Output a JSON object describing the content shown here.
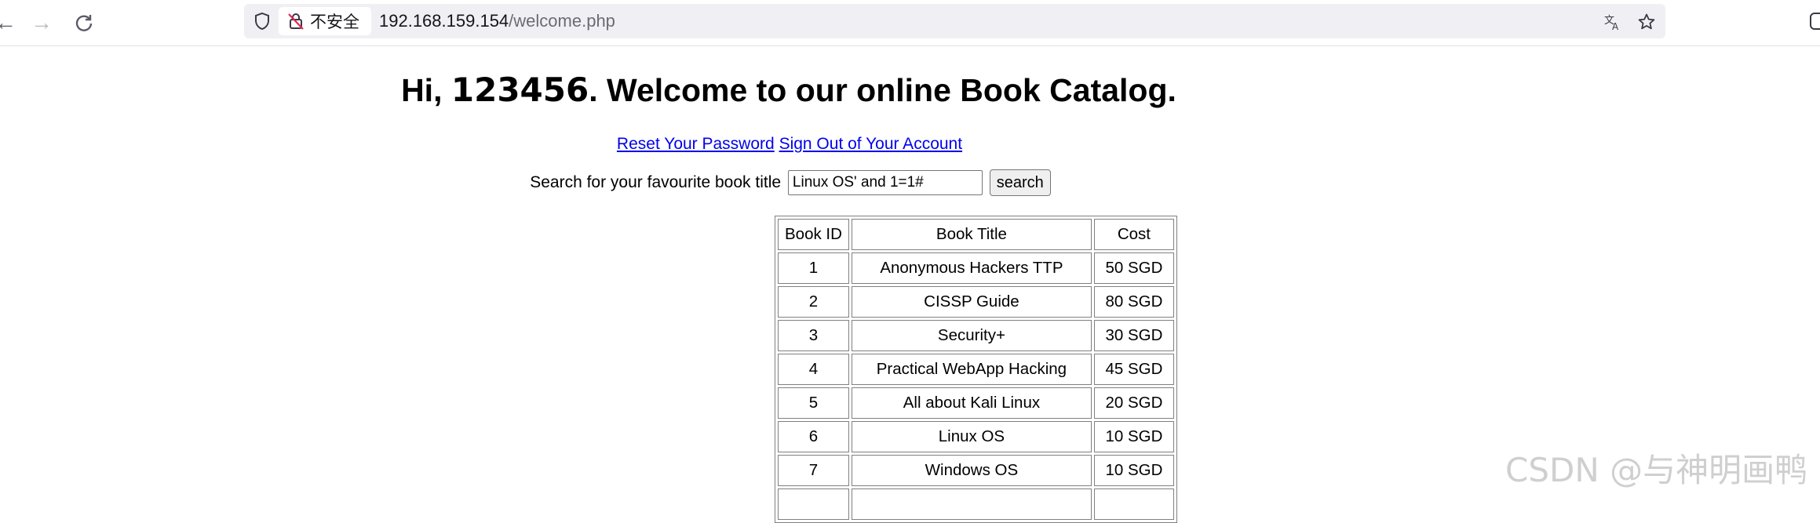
{
  "browser": {
    "insecure_label": "不安全",
    "url_host": "192.168.159.154",
    "url_path": "/welcome.php",
    "icons": [
      "back-icon",
      "forward-icon",
      "reload-icon",
      "shield-icon",
      "insecure-lock-icon",
      "translate-icon",
      "bookmark-star-icon"
    ]
  },
  "header": {
    "greeting": "Hi, ",
    "username": "123456",
    "welcome_text": ". Welcome to our online Book Catalog."
  },
  "links": {
    "reset_password": "Reset Your Password",
    "sign_out": "Sign Out of Your Account"
  },
  "search": {
    "label": "Search for your favourite book title",
    "value": "Linux OS' and 1=1#",
    "button_label": "search"
  },
  "table": {
    "headers": [
      "Book ID",
      "Book Title",
      "Cost"
    ],
    "rows": [
      [
        "1",
        "Anonymous Hackers TTP",
        "50 SGD"
      ],
      [
        "2",
        "CISSP Guide",
        "80 SGD"
      ],
      [
        "3",
        "Security+",
        "30 SGD"
      ],
      [
        "4",
        "Practical WebApp Hacking",
        "45 SGD"
      ],
      [
        "5",
        "All about Kali Linux",
        "20 SGD"
      ],
      [
        "6",
        "Linux OS",
        "10 SGD"
      ],
      [
        "7",
        "Windows OS",
        "10 SGD"
      ],
      [
        "",
        "",
        ""
      ]
    ]
  },
  "watermark": "CSDN @与神明画鸭",
  "colors": {
    "link": "#0000ee",
    "urlbar_bg": "#f0f0f4",
    "insecure_red": "#e22850"
  }
}
